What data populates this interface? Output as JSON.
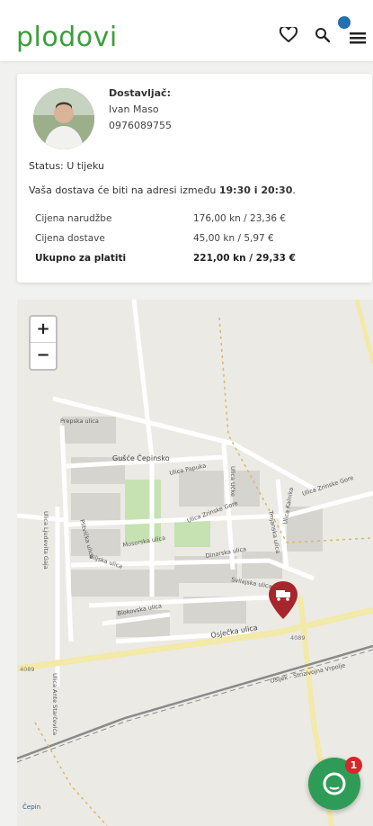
{
  "header": {
    "logo": "plodovi",
    "notification_dot_color": "#2370b0"
  },
  "courier": {
    "title": "Dostavljač:",
    "name": "Ivan Maso",
    "phone": "0976089755"
  },
  "status": "Status: U tijeku",
  "delivery": {
    "prefix": "Vaša dostava će biti na adresi između ",
    "from": "19:30",
    "connector": " i ",
    "to": "20:30",
    "suffix": "."
  },
  "order_summary": [
    {
      "label": "Cijena narudžbe",
      "value": "176,00 kn / 23,36 €"
    },
    {
      "label": "Cijena dostave",
      "value": "45,00 kn / 5,97 €"
    },
    {
      "label": "Ukupno za platiti",
      "value": "221,00 kn / 29,33 €"
    }
  ],
  "map": {
    "zoom_in": "+",
    "zoom_out": "−",
    "labels": {
      "village": "Gušće Čepinsko",
      "street_1": "Prepska ulica",
      "street_2": "Ulica Papuka",
      "street_3": "Ulica Zrinske Gore",
      "street_4": "Ulica Zrinske Gore",
      "street_5": "Mosorska ulica",
      "street_6": "Dinarska ulica",
      "street_7": "Biljska ulica",
      "street_8": "Svilajska ulica",
      "street_9": "Biokovska ulica",
      "street_10": "Osječka ulica",
      "street_11": "Ulica Ljudevita Gaja",
      "road_1": "4089",
      "road_2": "4089",
      "road_3": "Osijek - Strizivojna Vrpolje",
      "town": "Čepin",
      "street_12": "Ulica Kalnika",
      "street_13": "Trnjanska ulica",
      "street_14": "Ulica Učke",
      "street_15": "Ulica Ante Starčevića",
      "street_16": "Plitvička ulica"
    },
    "marker_color": "#a6262b"
  },
  "chat": {
    "badge": "1",
    "color": "#2e9c56"
  }
}
